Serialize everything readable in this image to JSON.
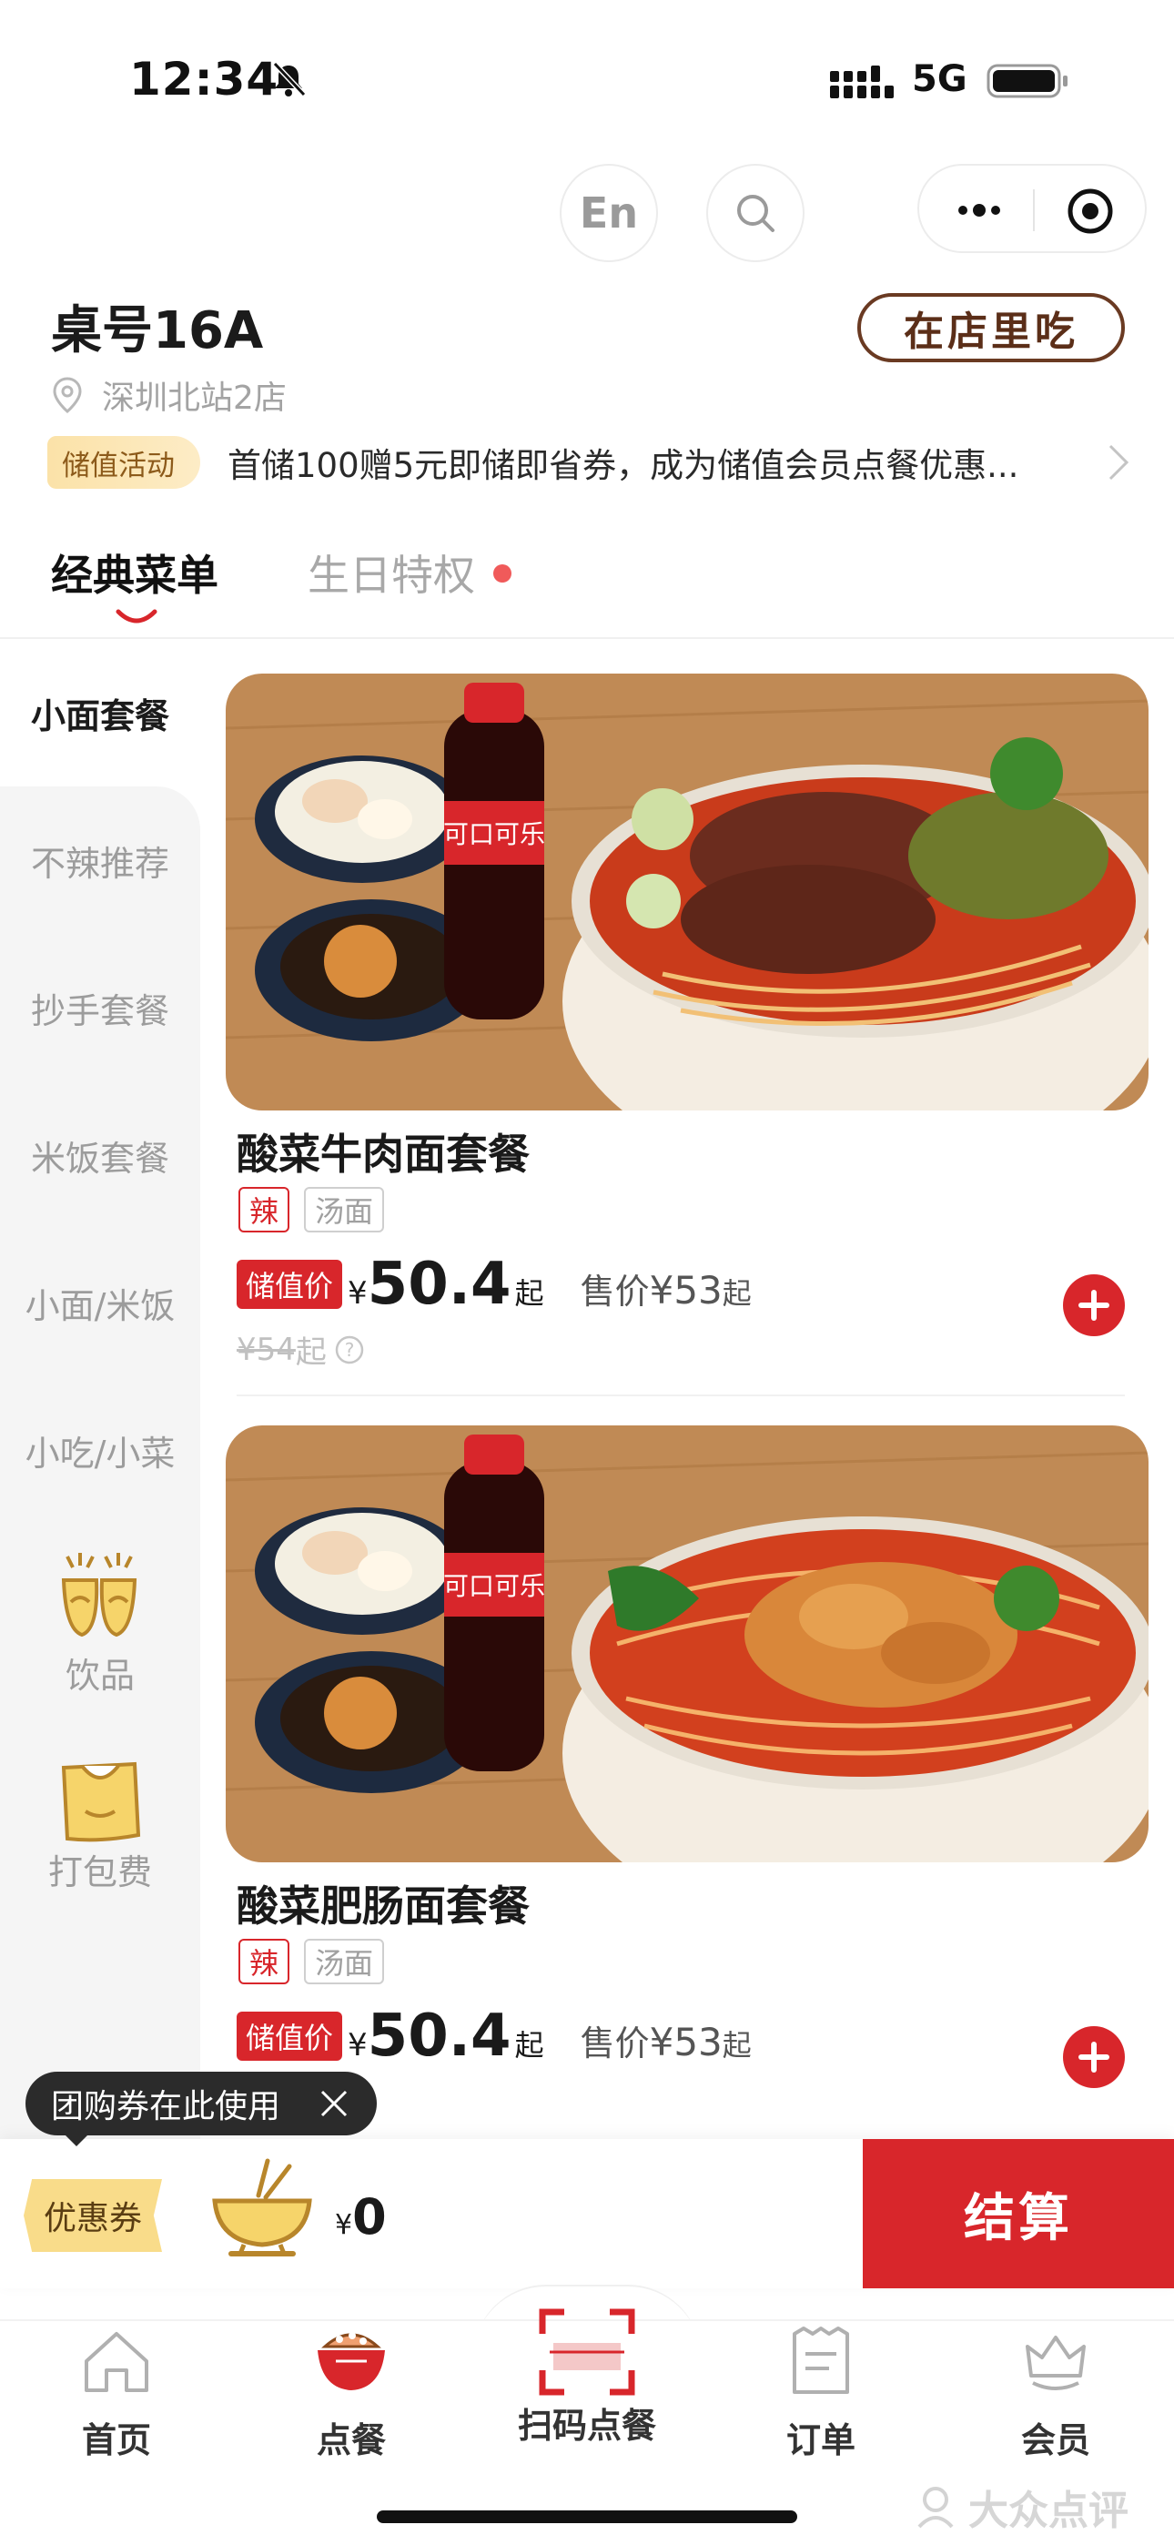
{
  "status_bar": {
    "time": "12:34",
    "network": "5G"
  },
  "header": {
    "language_button": "En",
    "table_number": "桌号16A",
    "dine_mode": "在店里吃",
    "store_name": "深圳北站2店",
    "promo_tag": "储值活动",
    "promo_text": "首储100赠5元即储即省券，成为储值会员点餐优惠..."
  },
  "tabs": [
    {
      "label": "经典菜单",
      "active": true
    },
    {
      "label": "生日特权",
      "active": false
    }
  ],
  "categories": [
    {
      "label": "小面套餐",
      "active": true
    },
    {
      "label": "不辣推荐"
    },
    {
      "label": "抄手套餐"
    },
    {
      "label": "米饭套餐"
    },
    {
      "label": "小面/米饭"
    },
    {
      "label": "小吃/小菜"
    },
    {
      "label": "饮品",
      "icon": "drink-cups-icon"
    },
    {
      "label": "打包费",
      "icon": "takeout-bag-icon"
    }
  ],
  "products": [
    {
      "name": "酸菜牛肉面套餐",
      "tags": [
        "辣",
        "汤面"
      ],
      "member_label": "储值价",
      "currency": "¥",
      "member_price": "50.4",
      "price_suffix": "起",
      "sale_label": "售价",
      "sale_price": "¥53",
      "original_price": "¥54",
      "image": "beef-noodle-combo-photo"
    },
    {
      "name": "酸菜肥肠面套餐",
      "tags": [
        "辣",
        "汤面"
      ],
      "member_label": "储值价",
      "currency": "¥",
      "member_price": "50.4",
      "price_suffix": "起",
      "sale_label": "售价",
      "sale_price": "¥53",
      "image": "intestine-noodle-combo-photo"
    }
  ],
  "coupon_tip": "团购券在此使用",
  "cart": {
    "coupon_label": "优惠券",
    "currency": "¥",
    "total": "0",
    "checkout_label": "结算"
  },
  "bottom_nav": [
    {
      "label": "首页",
      "icon": "home-icon"
    },
    {
      "label": "点餐",
      "icon": "order-bowl-icon"
    },
    {
      "label": "扫码点餐",
      "icon": "scan-icon"
    },
    {
      "label": "订单",
      "icon": "receipt-icon"
    },
    {
      "label": "会员",
      "icon": "member-crown-icon"
    }
  ],
  "watermark": "大众点评",
  "colors": {
    "brand_red": "#d8262b",
    "gold": "#f9dc8a",
    "sidebar_bg": "#f5f5f5"
  }
}
